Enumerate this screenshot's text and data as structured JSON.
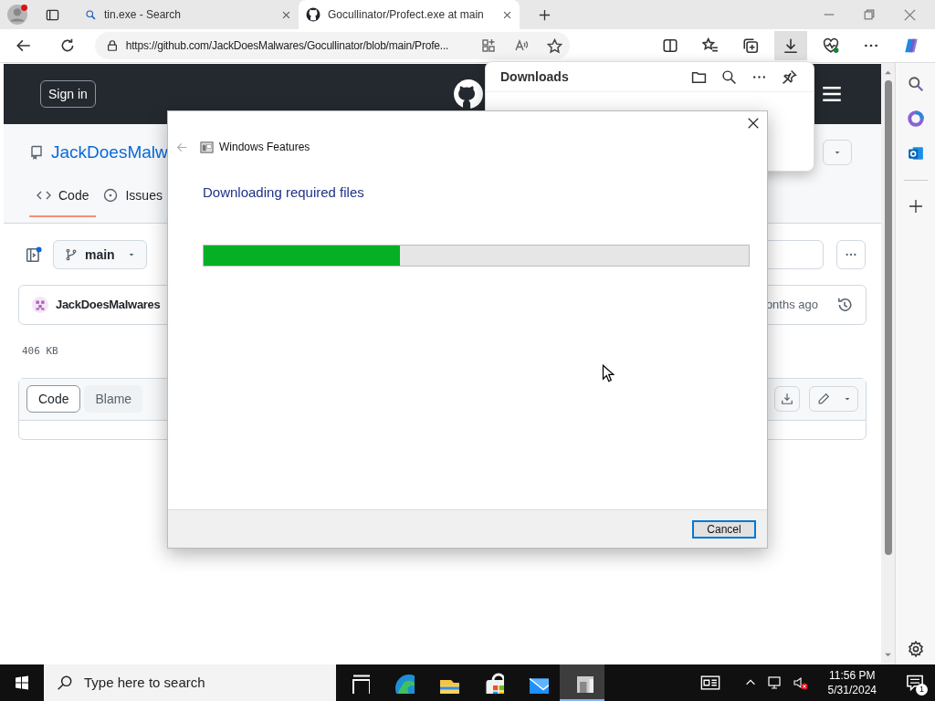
{
  "browser": {
    "tabs": [
      {
        "title": "tin.exe - Search",
        "selected": false
      },
      {
        "title": "Gocullinator/Profect.exe at main",
        "selected": true
      }
    ],
    "url": "https://github.com/JackDoesMalwares/Gocullinator/blob/main/Profe..."
  },
  "github": {
    "sign_in": "Sign in",
    "repo_title": "JackDoesMalw",
    "tabs": [
      {
        "label": "Code",
        "selected": true
      },
      {
        "label": "Issues",
        "selected": false
      }
    ],
    "branch": "main",
    "commit_author": "JackDoesMalwares",
    "commit_time": "onths ago",
    "file_size": "406 KB",
    "view_tabs": [
      {
        "label": "Code",
        "selected": true
      },
      {
        "label": "Blame",
        "selected": false
      }
    ]
  },
  "downloads_panel": {
    "title": "Downloads"
  },
  "dialog": {
    "title": "Windows Features",
    "heading": "Downloading required files",
    "level": 0.36,
    "cancel": "Cancel"
  },
  "taskbar": {
    "search_placeholder": "Type here to search",
    "time": "11:56 PM",
    "date": "5/31/2024",
    "notification_count": "1"
  }
}
